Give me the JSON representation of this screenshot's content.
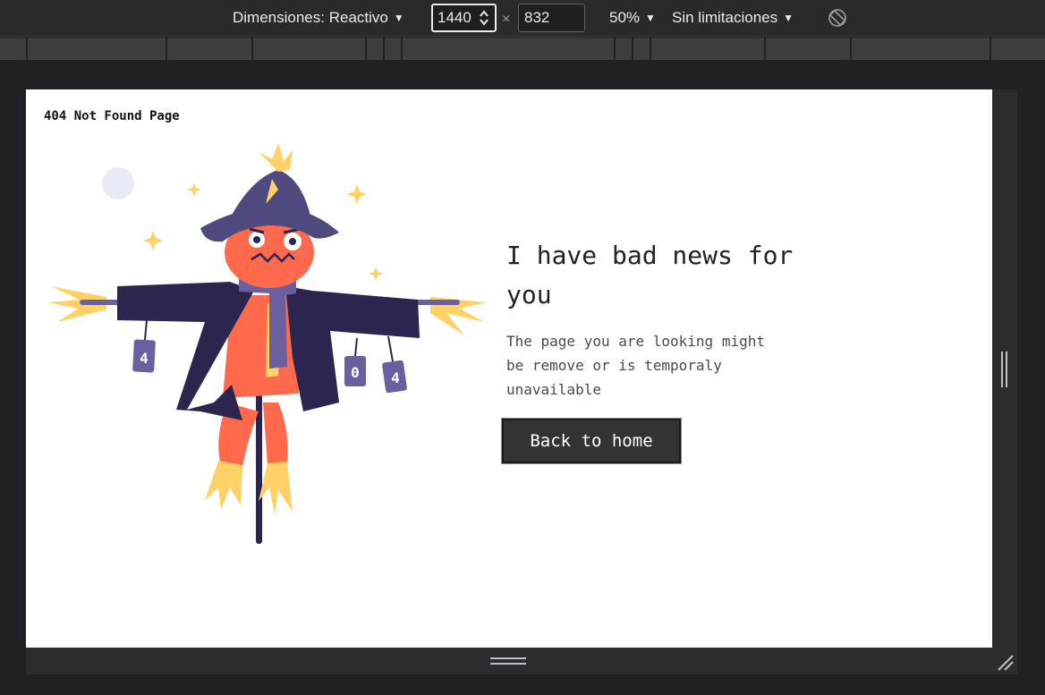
{
  "toolbar": {
    "dimensions_label": "Dimensiones: Reactivo",
    "width_value": "1440",
    "height_value": "832",
    "times_symbol": "×",
    "zoom_label": "50%",
    "throttle_label": "Sin limitaciones",
    "caret_glyph": "▼"
  },
  "page": {
    "tab_title": "404 Not Found Page",
    "headline": "I have bad news for you",
    "message": "The page you are looking might be remove or is temporaly unavailable",
    "button_label": "Back to home",
    "can_labels": [
      "4",
      "0",
      "4"
    ]
  },
  "colors": {
    "hat": "#4e4a7d",
    "face": "#ff6a4d",
    "coat": "#2c2550",
    "straw": "#ffd166",
    "scarf": "#6b5fa0",
    "moon": "#e8eaf6",
    "button_bg": "#333333"
  }
}
